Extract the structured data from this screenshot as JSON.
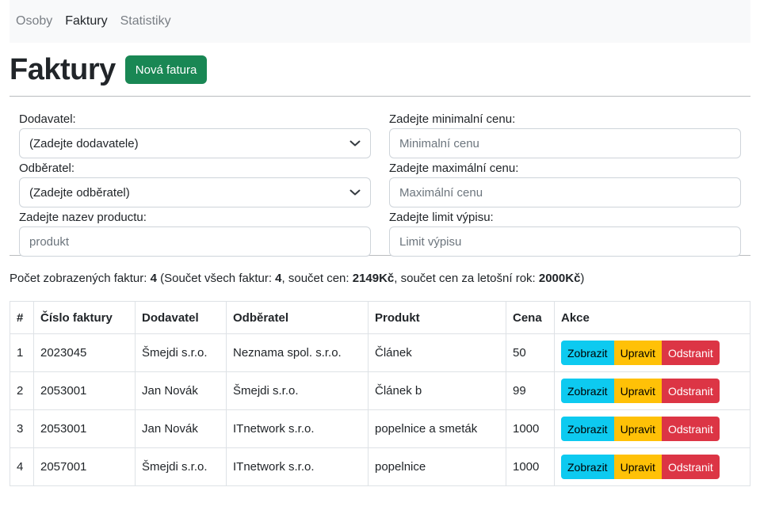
{
  "nav": {
    "items": [
      {
        "label": "Osoby",
        "active": false
      },
      {
        "label": "Faktury",
        "active": true
      },
      {
        "label": "Statistiky",
        "active": false
      }
    ]
  },
  "header": {
    "title": "Faktury",
    "new_button": "Nová fatura"
  },
  "filter": {
    "supplier": {
      "label": "Dodavatel:",
      "value": "(Zadejte dodavatele)"
    },
    "buyer": {
      "label": "Odběratel:",
      "value": "(Zadejte odběratel)"
    },
    "product": {
      "label": "Zadejte nazev productu:",
      "placeholder": "produkt"
    },
    "min_price": {
      "label": "Zadejte minimalní cenu:",
      "placeholder": "Minimalní cenu"
    },
    "max_price": {
      "label": "Zadejte maximální cenu:",
      "placeholder": "Maximální cenu"
    },
    "limit": {
      "label": "Zadejte limit výpisu:",
      "placeholder": "Limit výpisu"
    }
  },
  "summary": {
    "prefix": "Počet zobrazených faktur: ",
    "shown_count": "4",
    "part2": " (Součet všech faktur: ",
    "total_count": "4",
    "part3": ", součet cen: ",
    "total_sum": "2149Kč",
    "part4": ", součet cen za letošní rok: ",
    "year_sum": "2000Kč",
    "suffix": ")"
  },
  "table": {
    "headers": [
      "#",
      "Číslo faktury",
      "Dodavatel",
      "Odběratel",
      "Produkt",
      "Cena",
      "Akce"
    ],
    "rows": [
      {
        "index": "1",
        "number": "2023045",
        "supplier": "Šmejdi s.r.o.",
        "buyer": "Neznama spol. s.r.o.",
        "product": "Článek",
        "price": "50"
      },
      {
        "index": "2",
        "number": "2053001",
        "supplier": "Jan Novák",
        "buyer": "Šmejdi s.r.o.",
        "product": "Článek b",
        "price": "99"
      },
      {
        "index": "3",
        "number": "2053001",
        "supplier": "Jan Novák",
        "buyer": "ITnetwork s.r.o.",
        "product": "popelnice a smeták",
        "price": "1000"
      },
      {
        "index": "4",
        "number": "2057001",
        "supplier": "Šmejdi s.r.o.",
        "buyer": "ITnetwork s.r.o.",
        "product": "popelnice",
        "price": "1000"
      }
    ],
    "actions": {
      "show": "Zobrazit",
      "edit": "Upravit",
      "delete": "Odstranit"
    }
  },
  "colors": {
    "success": "#198754",
    "info": "#0dcaf0",
    "warning": "#ffc107",
    "danger": "#dc3545",
    "navbar_bg": "#f8f9fa"
  },
  "icons": {
    "select_arrow": "chevron-down-icon"
  }
}
